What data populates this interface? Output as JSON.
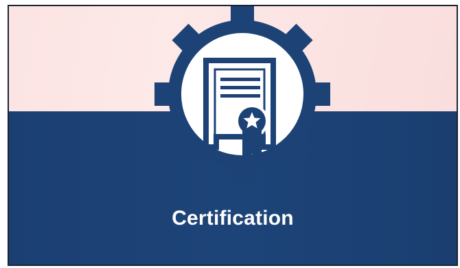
{
  "card": {
    "caption": "Certification"
  },
  "colors": {
    "top_band": "#fbe4e3",
    "bottom_band": "#1c4276",
    "gear": "#1c4276",
    "badge_circle": "#ffffff",
    "caption_text": "#ffffff"
  },
  "icons": {
    "emblem": "gear-icon",
    "document": "certificate-icon",
    "seal": "star-ribbon-icon"
  }
}
